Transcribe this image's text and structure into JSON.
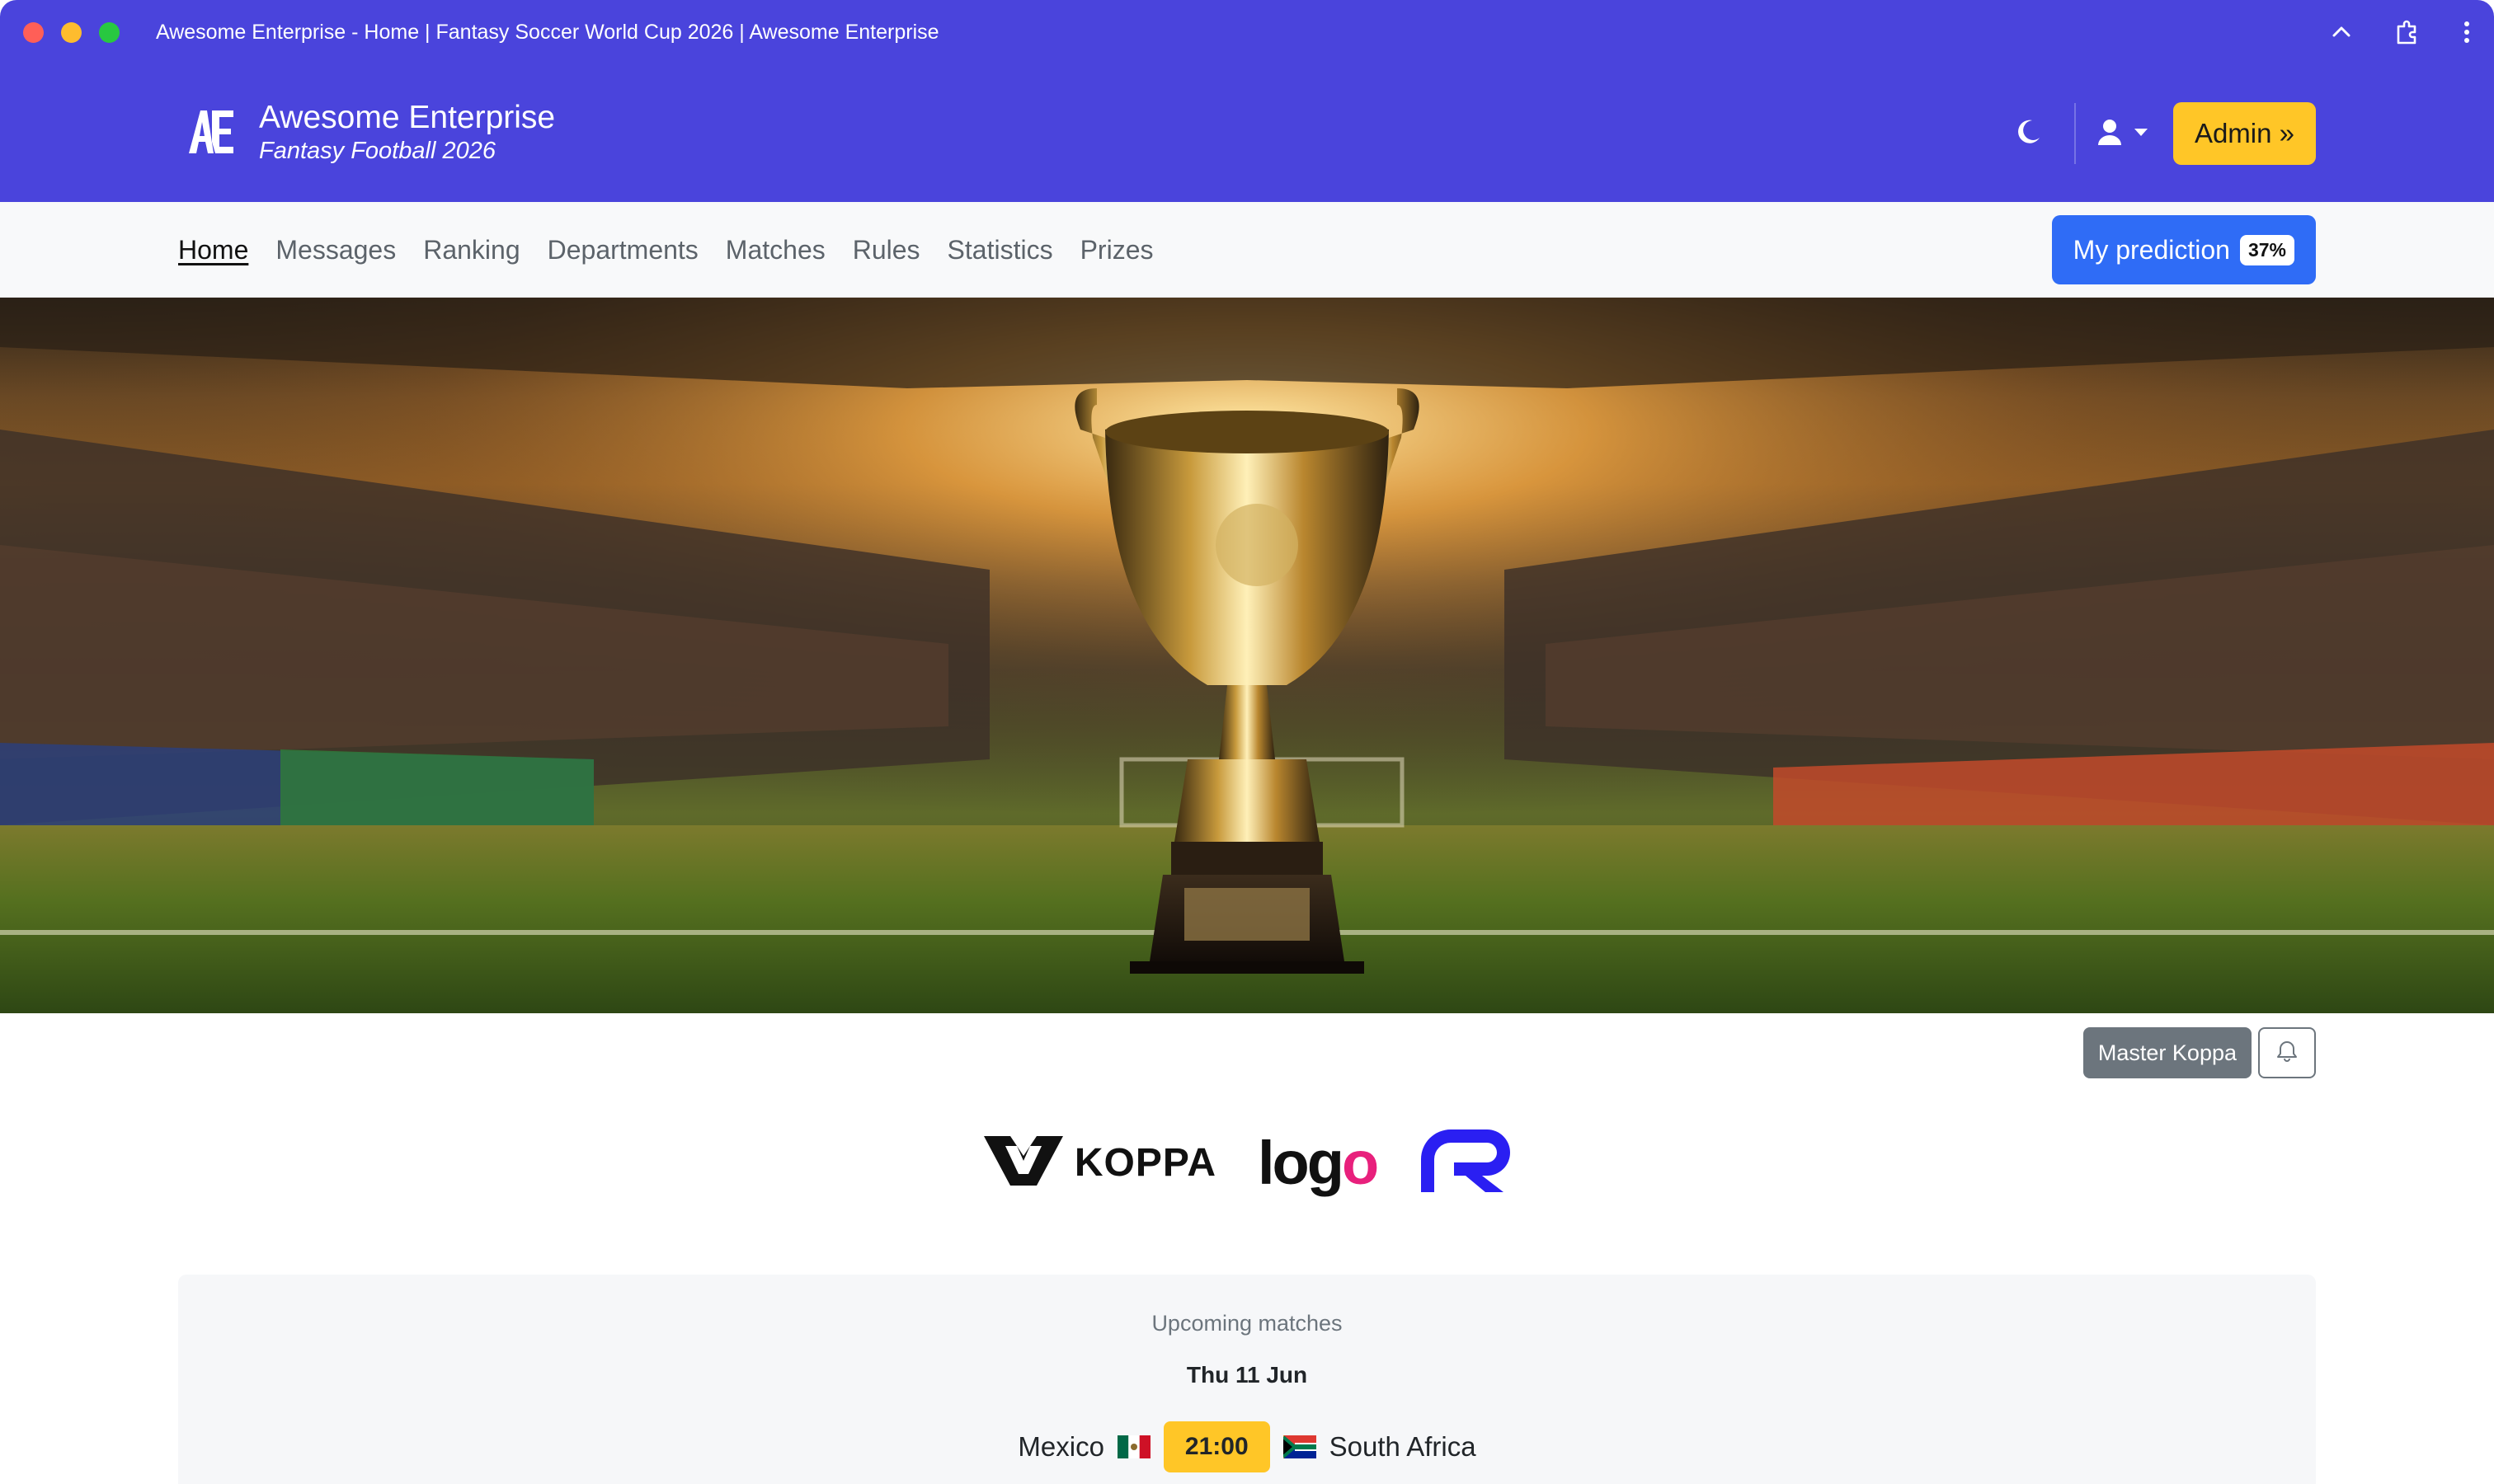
{
  "window": {
    "title": "Awesome Enterprise - Home | Fantasy Soccer World Cup 2026 | Awesome Enterprise"
  },
  "header": {
    "brand_name": "Awesome Enterprise",
    "brand_subtitle": "Fantasy Football 2026",
    "logo_text": "AE",
    "admin_label": "Admin »",
    "accent_color": "#4a44dc",
    "admin_color": "#ffc627"
  },
  "nav": {
    "items": [
      {
        "label": "Home"
      },
      {
        "label": "Messages"
      },
      {
        "label": "Ranking"
      },
      {
        "label": "Departments"
      },
      {
        "label": "Matches"
      },
      {
        "label": "Rules"
      },
      {
        "label": "Statistics"
      },
      {
        "label": "Prizes"
      }
    ],
    "active": "Home",
    "prediction_label": "My prediction",
    "prediction_progress": "37%",
    "prediction_color": "#2f6cf6"
  },
  "owner": {
    "name": "Master Koppa"
  },
  "sponsors": {
    "koppa": "KOPPA",
    "logo": "logo"
  },
  "matches": {
    "title": "Upcoming matches",
    "date": "Thu 11 Jun",
    "home_team": "Mexico",
    "away_team": "South Africa",
    "kickoff": "21:00"
  }
}
